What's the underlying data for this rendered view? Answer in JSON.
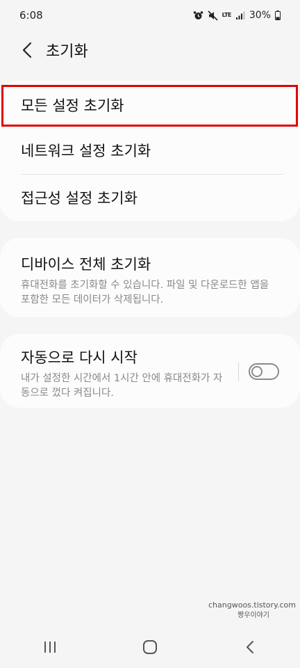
{
  "status_bar": {
    "time": "6:08",
    "network": "LTE",
    "battery": "30%",
    "icons": [
      "alarm-icon",
      "mute-icon",
      "lte-icon",
      "signal-icon",
      "battery-icon"
    ]
  },
  "header": {
    "back_icon": "chevron-left-icon",
    "title": "초기화"
  },
  "reset_options": [
    {
      "label": "모든 설정 초기화",
      "highlighted": true
    },
    {
      "label": "네트워크 설정 초기화"
    },
    {
      "label": "접근성 설정 초기화"
    }
  ],
  "factory_reset": {
    "title": "디바이스 전체 초기화",
    "description": "휴대전화를 초기화할 수 있습니다. 파일 및 다운로드한 앱을 포함한 모든 데이터가 삭제됩니다."
  },
  "auto_restart": {
    "title": "자동으로 다시 시작",
    "description": "내가 설정한 시간에서 1시간 안에 휴대전화가 자동으로 껐다 켜집니다.",
    "toggle_on": false
  },
  "watermark": {
    "line1": "changwoos.tistory.com",
    "line2": "짱우이야기"
  },
  "nav_bar": {
    "icons": [
      "recent-apps-icon",
      "home-icon",
      "back-icon"
    ]
  },
  "colors": {
    "highlight": "#e00000",
    "background": "#f5f5f5",
    "card": "#fcfcfc"
  }
}
